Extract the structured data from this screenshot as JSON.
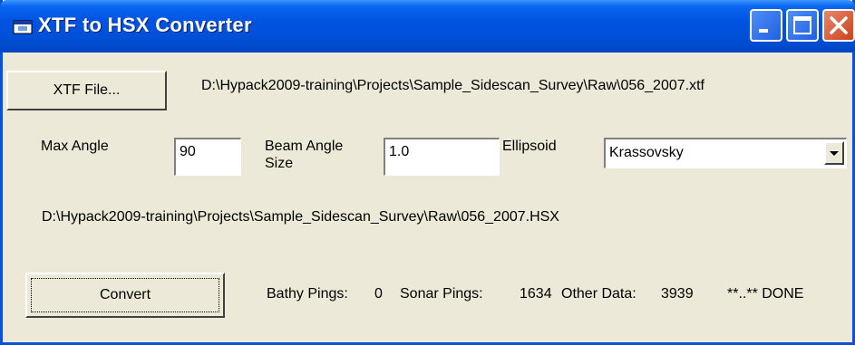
{
  "window": {
    "title": "XTF to HSX Converter"
  },
  "xtf_file": {
    "button_label": "XTF File...",
    "path": "D:\\Hypack2009-training\\Projects\\Sample_Sidescan_Survey\\Raw\\056_2007.xtf"
  },
  "settings": {
    "max_angle_label": "Max Angle",
    "max_angle_value": "90",
    "beam_angle_label_line1": "Beam Angle",
    "beam_angle_label_line2": "Size",
    "beam_angle_value": "1.0",
    "ellipsoid_label": "Ellipsoid",
    "ellipsoid_selected": "Krassovsky"
  },
  "output_path": "D:\\Hypack2009-training\\Projects\\Sample_Sidescan_Survey\\Raw\\056_2007.HSX",
  "convert": {
    "button_label": "Convert"
  },
  "status": {
    "bathy_label": "Bathy Pings:",
    "bathy_value": "0",
    "sonar_label": "Sonar Pings:",
    "sonar_value": "1634",
    "other_label": "Other Data:",
    "other_value": "3939",
    "done_text": "**..** DONE"
  },
  "icons": {
    "app": "app-window-icon",
    "minimize": "minimize-icon",
    "maximize": "maximize-icon",
    "close": "close-icon",
    "dropdown": "chevron-down-icon"
  }
}
